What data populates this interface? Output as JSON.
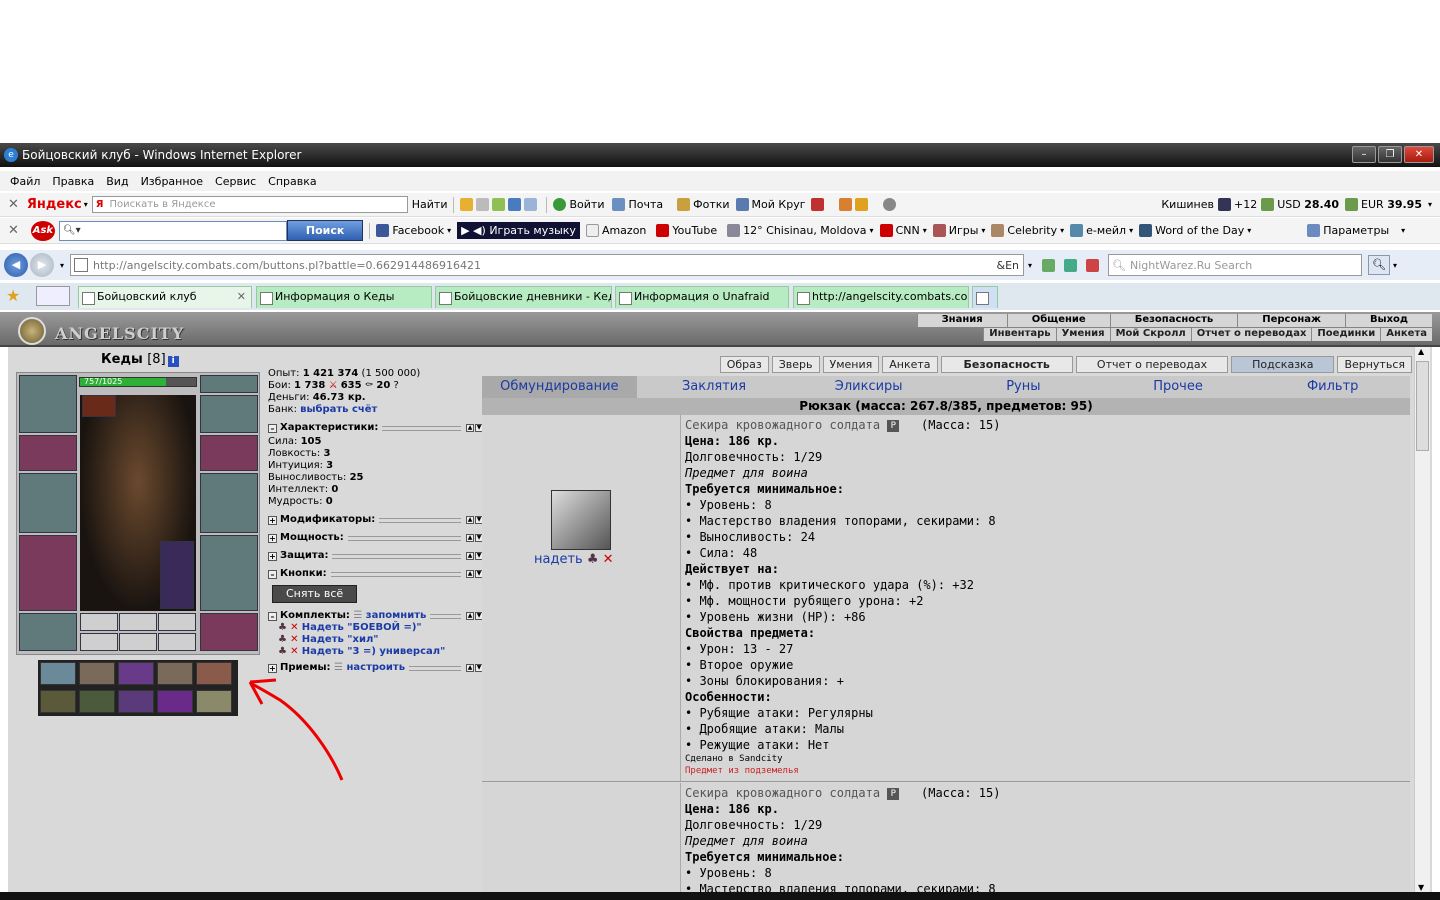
{
  "window": {
    "title": "Бойцовский клуб - Windows Internet Explorer"
  },
  "menu": [
    "Файл",
    "Правка",
    "Вид",
    "Избранное",
    "Сервис",
    "Справка"
  ],
  "yandex_bar": {
    "brand": "Яндекс",
    "search_placeholder": "Поискать в Яндексе",
    "find_button": "Найти",
    "login": "Войти",
    "mail": "Почта",
    "photos": "Фотки",
    "mycircle": "Мой Круг",
    "city": "Кишинев",
    "temp": "+12",
    "usd_label": "USD",
    "usd": "28.40",
    "eur_label": "EUR",
    "eur": "39.95"
  },
  "ask_bar": {
    "search_button": "Поиск",
    "facebook": "Facebook",
    "play_music": "Играть музыку",
    "amazon": "Amazon",
    "youtube": "YouTube",
    "weather": "12° Chisinau, Moldova",
    "cnn": "CNN",
    "games": "Игры",
    "celebrity": "Celebrity",
    "email": "e-мейл",
    "word": "Word of the Day",
    "params": "Параметры"
  },
  "address": {
    "url": "http://angelscity.combats.com/buttons.pl?battle=0.662914486916421",
    "search_placeholder": "NightWarez.Ru Search"
  },
  "tabs": [
    "Бойцовский клуб",
    "Информация о Кеды",
    "Бойцовские дневники - Кеды",
    "Информация о Unafraid",
    "http://angelscity.combats.co..."
  ],
  "game": {
    "logo": "ANGELSCITY",
    "top_menu": [
      "Знания",
      "Общение",
      "Безопасность",
      "Персонаж",
      "Выход"
    ],
    "sub_menu": [
      "Инвентарь",
      "Умения",
      "Мой Скролл",
      "Отчет о переводах",
      "Поединки",
      "Анкета"
    ],
    "character": {
      "name": "Кеды",
      "level": "[8]",
      "hp": "757/1025",
      "hp_fraction": 0.74
    },
    "stats": {
      "exp_label": "Опыт:",
      "exp": "1 421 374",
      "exp_next": "(1 500 000)",
      "fights_label": "Бои:",
      "wins": "1 738",
      "losses": "635",
      "draws": "20",
      "money_label": "Деньги:",
      "money": "46.73 кр.",
      "bank_label": "Банк:",
      "bank_link": "выбрать счёт"
    },
    "char_section": "Характеристики:",
    "attributes": [
      {
        "label": "Сила:",
        "value": "105"
      },
      {
        "label": "Ловкость:",
        "value": "3"
      },
      {
        "label": "Интуиция:",
        "value": "3"
      },
      {
        "label": "Выносливость:",
        "value": "25"
      },
      {
        "label": "Интеллект:",
        "value": "0"
      },
      {
        "label": "Мудрость:",
        "value": "0"
      }
    ],
    "sections": [
      "Модификаторы:",
      "Мощность:",
      "Защита:",
      "Кнопки:"
    ],
    "remove_all": "Снять всё",
    "sets_label": "Комплекты:",
    "sets_remember": "запомнить",
    "sets": [
      "Надеть \"БОЕВОЙ =)\"",
      "Надеть \"хил\"",
      "Надеть \"3 =) универсал\""
    ],
    "tricks_label": "Приемы:",
    "tricks_setup": "настроить",
    "top_buttons": [
      "Образ",
      "Зверь",
      "Умения",
      "Анкета",
      "Безопасность",
      "Отчет о переводах",
      "Подсказка",
      "Вернуться"
    ],
    "categories": [
      "Обмундирование",
      "Заклятия",
      "Эликсиры",
      "Руны",
      "Прочее",
      "Фильтр"
    ],
    "backpack": "Рюкзак (масса: 267.8/385, предметов: 95)",
    "wear": "надеть",
    "item1": {
      "name": "Секира кровожадного солдата",
      "mass": "(Масса: 15)",
      "price": "Цена: 186 кр.",
      "durability": "Долговечность: 1/29",
      "for": "Предмет для воина",
      "req_title": "Требуется минимальное:",
      "reqs": [
        "• Уровень: 8",
        "• Мастерство владения топорами, секирами: 8",
        "• Выносливость: 24",
        "• Сила: 48"
      ],
      "acts_title": "Действует на:",
      "acts": [
        "• Мф. против критического удара (%): +32",
        "• Мф. мощности рубящего урона: +2",
        "• Уровень жизни (HP): +86"
      ],
      "props_title": "Свойства предмета:",
      "props": [
        "• Урон: 13 - 27",
        "• Второе оружие",
        "• Зоны блокирования: +"
      ],
      "feat_title": "Особенности:",
      "feats": [
        "• Рубящие атаки: Регулярны",
        "• Дробящие атаки: Малы",
        "• Режущие атаки: Нет"
      ],
      "made": "Сделано в Sandcity",
      "dungeon": "Предмет из подземелья"
    },
    "item2": {
      "name": "Секира кровожадного солдата",
      "mass": "(Масса: 15)",
      "price": "Цена: 186 кр.",
      "durability": "Долговечность: 1/29",
      "for": "Предмет для воина",
      "req_title": "Требуется минимальное:",
      "reqs": [
        "• Уровень: 8",
        "• Мастерство владения топорами, секирами: 8"
      ]
    }
  }
}
